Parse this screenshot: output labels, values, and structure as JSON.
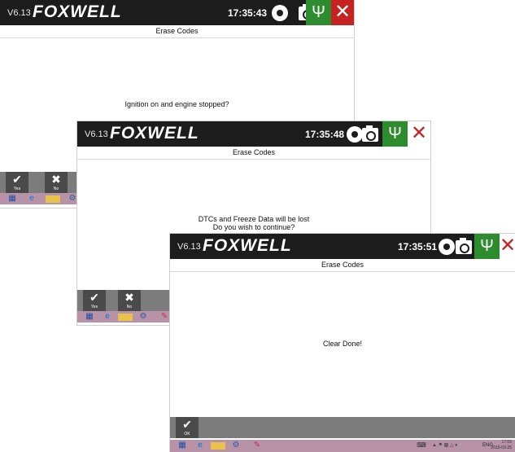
{
  "windows": [
    {
      "id": "w1",
      "version": "V6.13",
      "logo": "FOXWELL",
      "time": "17:35:43",
      "page_title": "Erase Codes",
      "message_lines": [
        "Ignition on and engine stopped?"
      ],
      "buttons": [
        {
          "label": "Yes",
          "icon": "check-icon"
        },
        {
          "label": "No",
          "icon": "x-icon"
        }
      ]
    },
    {
      "id": "w2",
      "version": "V6.13",
      "logo": "FOXWELL",
      "time": "17:35:48",
      "page_title": "Erase Codes",
      "message_lines": [
        "DTCs and Freeze Data will be lost",
        "Do you wish to continue?"
      ],
      "buttons": [
        {
          "label": "Yes",
          "icon": "check-icon"
        },
        {
          "label": "No",
          "icon": "x-icon"
        }
      ]
    },
    {
      "id": "w3",
      "version": "V6.13",
      "logo": "FOXWELL",
      "time": "17:35:51",
      "page_title": "Erase Codes",
      "message_lines": [
        "Clear Done!"
      ],
      "buttons": [
        {
          "label": "OK",
          "icon": "check-icon"
        }
      ]
    }
  ],
  "toolbar_icons": {
    "record": "record-icon",
    "camera": "camera-icon",
    "usb": "usb-icon",
    "close": "close-icon"
  },
  "taskbar": {
    "language": "ENG",
    "time": "17:55",
    "date": "2015-03-25"
  },
  "colors": {
    "titlebar": "#1c1c1c",
    "usb_green": "#2d8c2e",
    "close_red": "#c72222",
    "button_bar": "#7c7c7c",
    "taskbar": "#b893a8"
  }
}
